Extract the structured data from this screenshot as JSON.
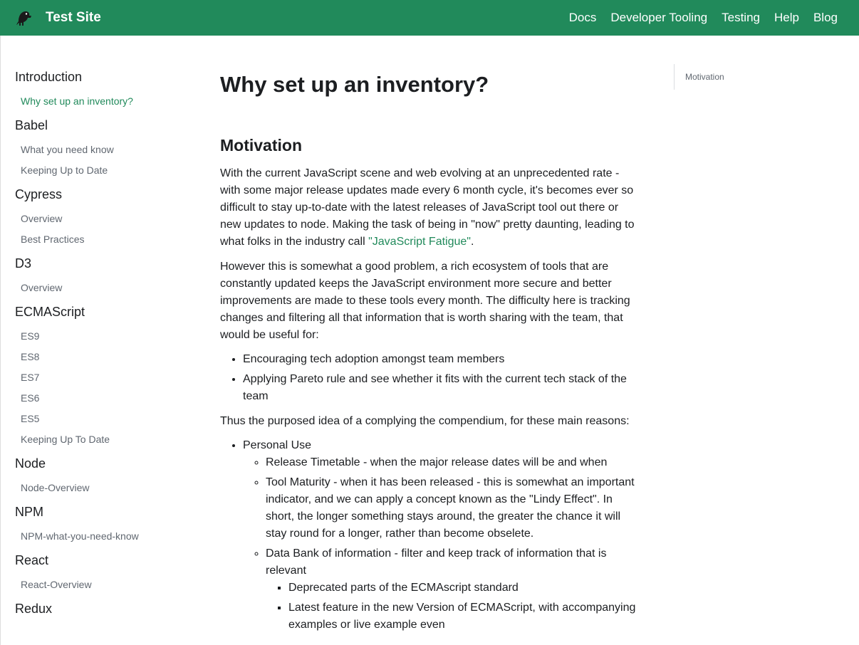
{
  "navbar": {
    "brand_title": "Test Site",
    "logo_icon": "dinosaur-logo-icon",
    "bg_color": "#218a5b",
    "links": [
      "Docs",
      "Developer Tooling",
      "Testing",
      "Help",
      "Blog"
    ]
  },
  "sidebar": {
    "groups": [
      {
        "title": "Introduction",
        "items": [
          "Why set up an inventory?"
        ]
      },
      {
        "title": "Babel",
        "items": [
          "What you need know",
          "Keeping Up to Date"
        ]
      },
      {
        "title": "Cypress",
        "items": [
          "Overview",
          "Best Practices"
        ]
      },
      {
        "title": "D3",
        "items": [
          "Overview"
        ]
      },
      {
        "title": "ECMAScript",
        "items": [
          "ES9",
          "ES8",
          "ES7",
          "ES6",
          "ES5",
          "Keeping Up To Date"
        ]
      },
      {
        "title": "Node",
        "items": [
          "Node-Overview"
        ]
      },
      {
        "title": "NPM",
        "items": [
          "NPM-what-you-need-know"
        ]
      },
      {
        "title": "React",
        "items": [
          "React-Overview"
        ]
      },
      {
        "title": "Redux",
        "items": []
      }
    ],
    "active_item": "Why set up an inventory?"
  },
  "article": {
    "title": "Why set up an inventory?",
    "section_heading": "Motivation",
    "p1_before_link": "With the current JavaScript scene and web evolving at an unprecedented rate - with some major release updates made every 6 month cycle, it's becomes ever so difficult to stay up-to-date with the latest releases of JavaScript tool out there or new updates to node. Making the task of being in \"now\" pretty daunting, leading to what folks in the industry call ",
    "p1_link": "\"JavaScript Fatigue\"",
    "p1_after_link": ".",
    "p2": "However this is somewhat a good problem, a rich ecosystem of tools that are constantly updated keeps the JavaScript environment more secure and better improvements are made to these tools every month. The difficulty here is tracking changes and filtering all that information that is worth sharing with the team, that would be useful for:",
    "list1": [
      "Encouraging tech adoption amongst team members",
      "Applying Pareto rule and see whether it fits with the current tech stack of the team"
    ],
    "p3": "Thus the purposed idea of a complying the compendium, for these main reasons:",
    "list2_item": "Personal Use",
    "list2_sub": [
      "Release Timetable - when the major release dates will be and when",
      "Tool Maturity - when it has been released - this is somewhat an important indicator, and we can apply a concept known as the \"Lindy Effect\". In short, the longer something stays around, the greater the chance it will stay round for a longer, rather than become obselete.",
      "Data Bank of information - filter and keep track of information that is relevant"
    ],
    "list2_subsub": [
      "Deprecated parts of the ECMAscript standard",
      "Latest feature in the new Version of ECMAScript, with accompanying examples or live example even"
    ]
  },
  "toc": {
    "items": [
      "Motivation"
    ]
  }
}
